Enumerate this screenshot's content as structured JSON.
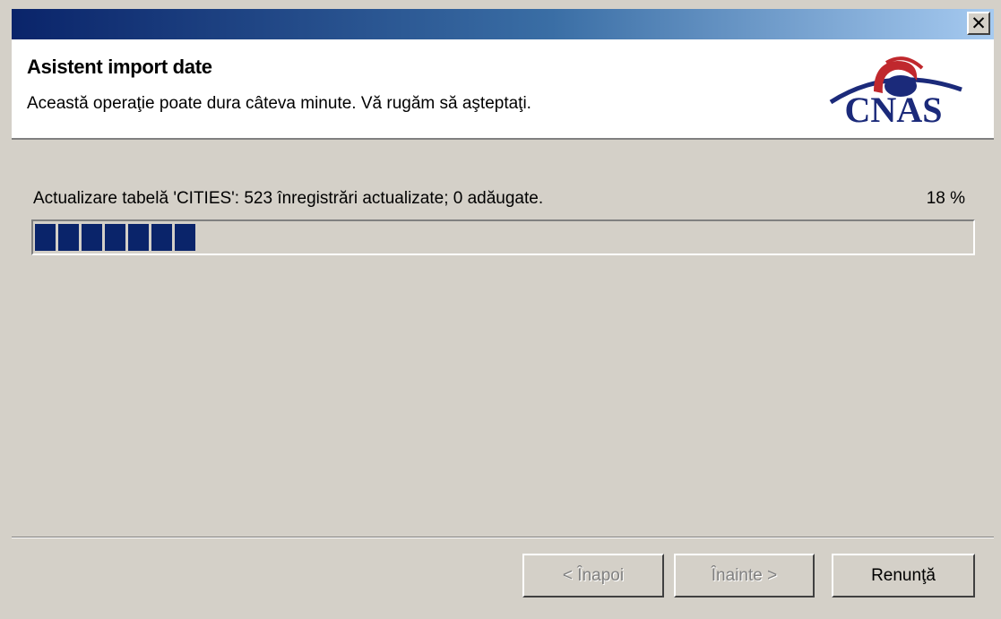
{
  "window": {
    "close_glyph": "✕"
  },
  "header": {
    "title": "Asistent import date",
    "subtitle": "Această operaţie poate dura câteva minute. Vă rugăm să aşteptaţi.",
    "logo_text": "CNAS",
    "logo_colors": {
      "text": "#1b2a7a",
      "swoosh": "#c0282d",
      "arc": "#1b2a7a"
    }
  },
  "progress": {
    "status": "Actualizare tabelă 'CITIES': 523 înregistrări actualizate; 0 adăugate.",
    "percent_label": "18 %",
    "fraction": 0.18,
    "color": "#0a246a"
  },
  "buttons": {
    "back_label": "< Înapoi",
    "next_label": "Înainte >",
    "cancel_label": "Renunţă"
  }
}
